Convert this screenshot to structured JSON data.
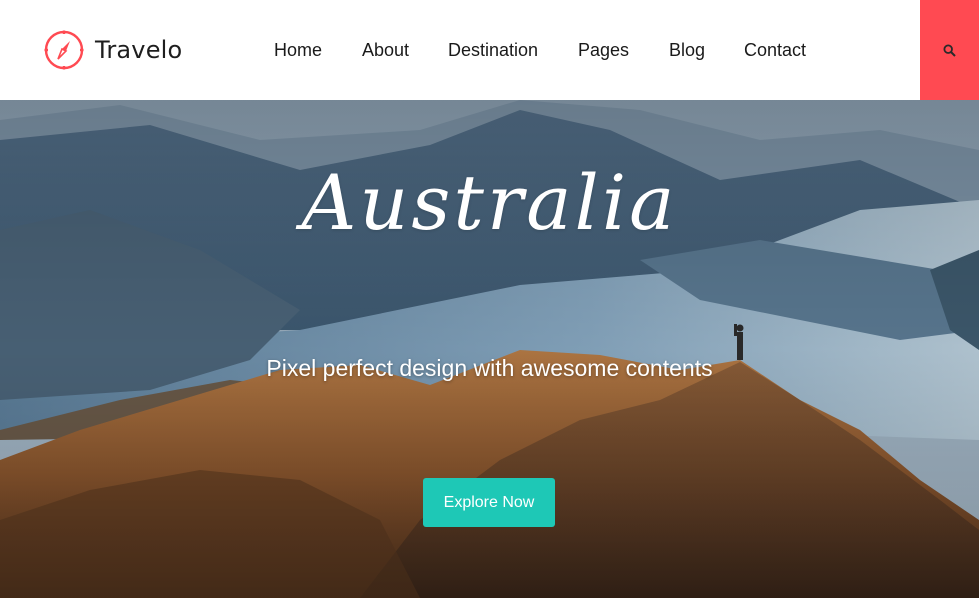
{
  "brand": {
    "name": "Travelo",
    "icon": "compass-icon",
    "accent_color": "#ff4a52"
  },
  "nav": {
    "items": [
      {
        "label": "Home"
      },
      {
        "label": "About"
      },
      {
        "label": "Destination"
      },
      {
        "label": "Pages"
      },
      {
        "label": "Blog"
      },
      {
        "label": "Contact"
      }
    ]
  },
  "search": {
    "icon": "search-icon",
    "background": "#ff4a52"
  },
  "hero": {
    "title": "Australia",
    "subtitle": "Pixel perfect design with awesome contents",
    "cta_label": "Explore Now",
    "cta_color": "#1ec8b6"
  }
}
